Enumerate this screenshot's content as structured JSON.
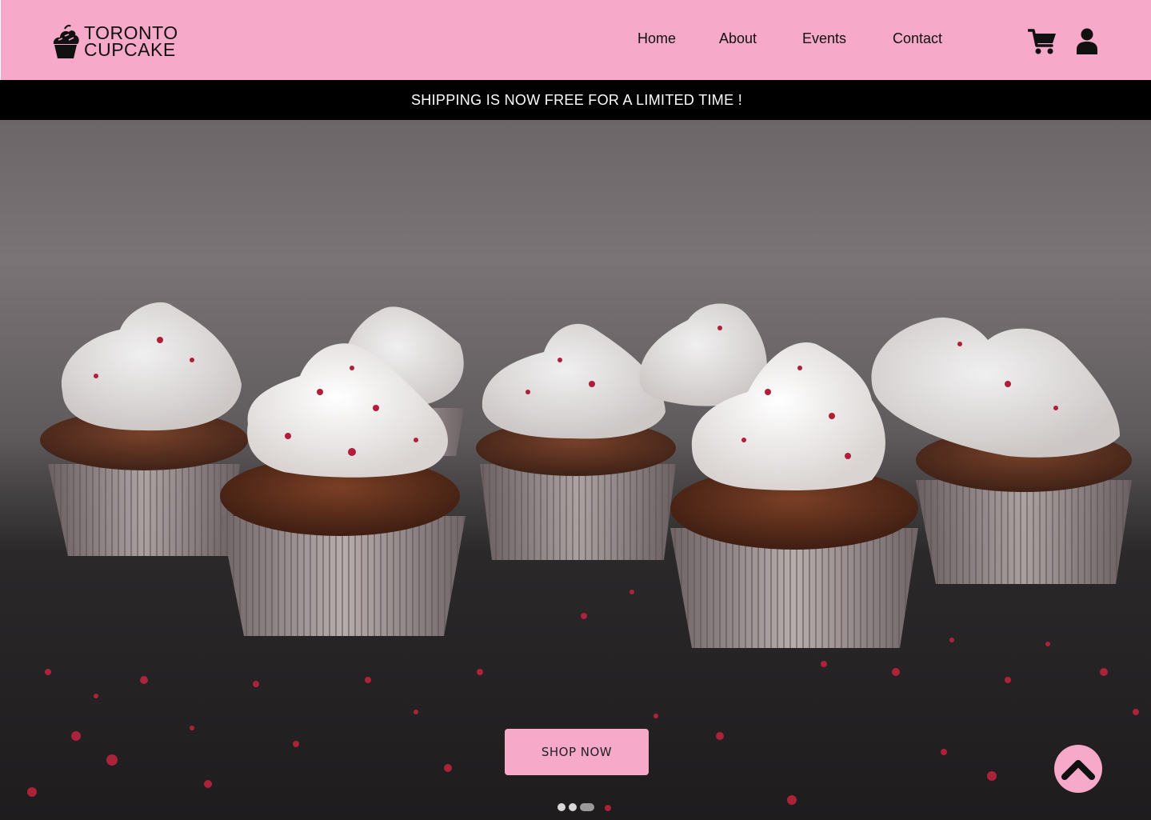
{
  "brand": {
    "line1": "TORONTO",
    "line2": "CUPCAKE",
    "color": "#f6a9c8"
  },
  "nav": {
    "items": [
      "Home",
      "About",
      "Events",
      "Contact"
    ]
  },
  "header_icons": {
    "cart": "cart-icon",
    "user": "user-icon"
  },
  "promo": {
    "text": "SHIPPING IS NOW FREE FOR A LIMITED TIME !"
  },
  "hero": {
    "image": "cupcakes-with-white-frosting-photo",
    "cta": "SHOP NOW",
    "slides_total": 3,
    "active_slide": 3
  },
  "scroll_top": {
    "icon": "chevron-up-icon"
  }
}
